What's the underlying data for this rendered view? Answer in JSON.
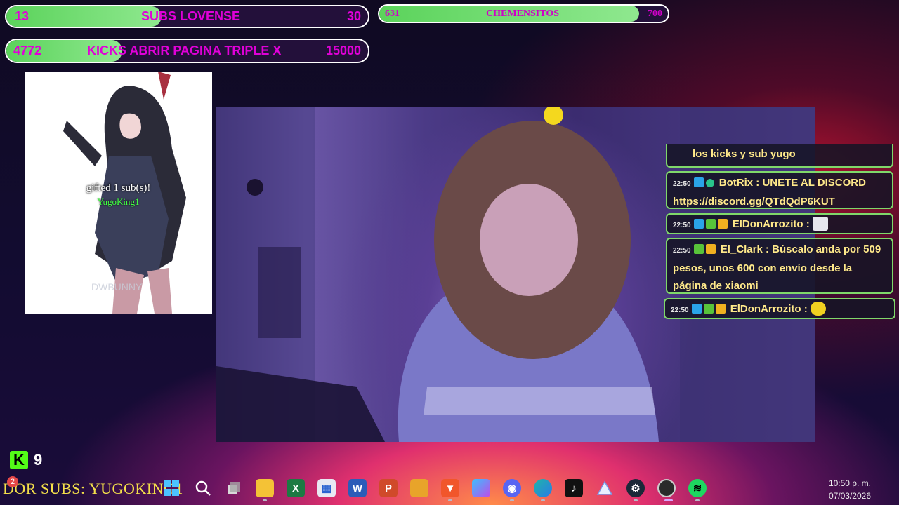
{
  "goals": [
    {
      "id": "subs",
      "current": "13",
      "label": "SUBS LOVENSE",
      "target": "30",
      "progress": 0.43
    },
    {
      "id": "chemensitos",
      "current": "631",
      "label": "CHEMENSITOS",
      "target": "700",
      "progress": 0.9
    },
    {
      "id": "kicks",
      "current": "4772",
      "label": "KICKS ABRIR PAGINA TRIPLE X",
      "target": "15000",
      "progress": 0.32
    }
  ],
  "alert": {
    "line1": "gifted 1 sub(s)!",
    "line2": "YugoKing1",
    "watermark": "DWBUNNY"
  },
  "chat": [
    {
      "id": "m0",
      "time": "",
      "user": "",
      "text": "los kicks y sub yugo"
    },
    {
      "id": "m1",
      "time": "22:50",
      "user": "BotRix",
      "text": "UNETE AL DISCORD https://discord.gg/QTdQdP6KUT"
    },
    {
      "id": "m2",
      "time": "22:50",
      "user": "ElDonArrozito",
      "text": ""
    },
    {
      "id": "m3",
      "time": "22:50",
      "user": "El_Clark",
      "text": "Búscalo anda por 509 pesos, unos 600 con envío desde la página de xiaomi"
    },
    {
      "id": "m4",
      "time": "22:50",
      "user": "ElDonArrozito",
      "text": ""
    }
  ],
  "kick_counter": {
    "value": "9"
  },
  "ticker": {
    "text": "DOR SUBS: YUGOKING1",
    "badge": "2"
  },
  "taskbar": {
    "apps": [
      "windows-start",
      "search",
      "task-view",
      "file-explorer",
      "excel",
      "ms-store",
      "word",
      "powerpoint",
      "folder",
      "brave",
      "copilot",
      "discord",
      "edge",
      "tiktok",
      "tradingview",
      "steam",
      "obs",
      "spotify"
    ]
  },
  "clock": {
    "time": "10:50 p. m.",
    "date": "07/03/2026"
  },
  "colors": {
    "accent_green": "#7fd86a",
    "chat_text": "#ffe98a",
    "bar_text": "#e000d8"
  }
}
